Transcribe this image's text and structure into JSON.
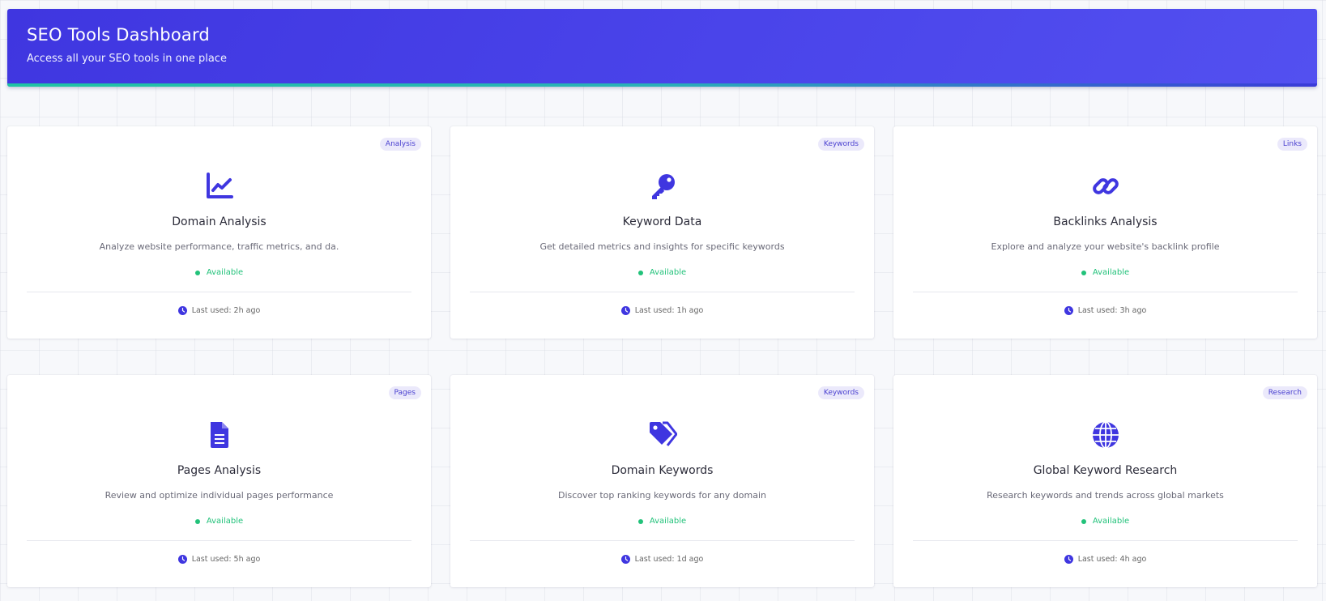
{
  "header": {
    "title": "SEO Tools Dashboard",
    "subtitle": "Access all your SEO tools in one place"
  },
  "colors": {
    "accent": "#3f36e0",
    "status_green": "#22c27a",
    "badge_bg": "#ebe9fb"
  },
  "cards": [
    {
      "badge": "Analysis",
      "icon": "chart-line-icon",
      "title": "Domain Analysis",
      "description": "Analyze website performance, traffic metrics, and da.",
      "status": "Available",
      "last_used": "Last used: 2h ago"
    },
    {
      "badge": "Keywords",
      "icon": "key-icon",
      "title": "Keyword Data",
      "description": "Get detailed metrics and insights for specific keywords",
      "status": "Available",
      "last_used": "Last used: 1h ago"
    },
    {
      "badge": "Links",
      "icon": "link-icon",
      "title": "Backlinks Analysis",
      "description": "Explore and analyze your website's backlink profile",
      "status": "Available",
      "last_used": "Last used: 3h ago"
    },
    {
      "badge": "Pages",
      "icon": "file-icon",
      "title": "Pages Analysis",
      "description": "Review and optimize individual pages performance",
      "status": "Available",
      "last_used": "Last used: 5h ago"
    },
    {
      "badge": "Keywords",
      "icon": "tags-icon",
      "title": "Domain Keywords",
      "description": "Discover top ranking keywords for any domain",
      "status": "Available",
      "last_used": "Last used: 1d ago"
    },
    {
      "badge": "Research",
      "icon": "globe-icon",
      "title": "Global Keyword Research",
      "description": "Research keywords and trends across global markets",
      "status": "Available",
      "last_used": "Last used: 4h ago"
    }
  ]
}
